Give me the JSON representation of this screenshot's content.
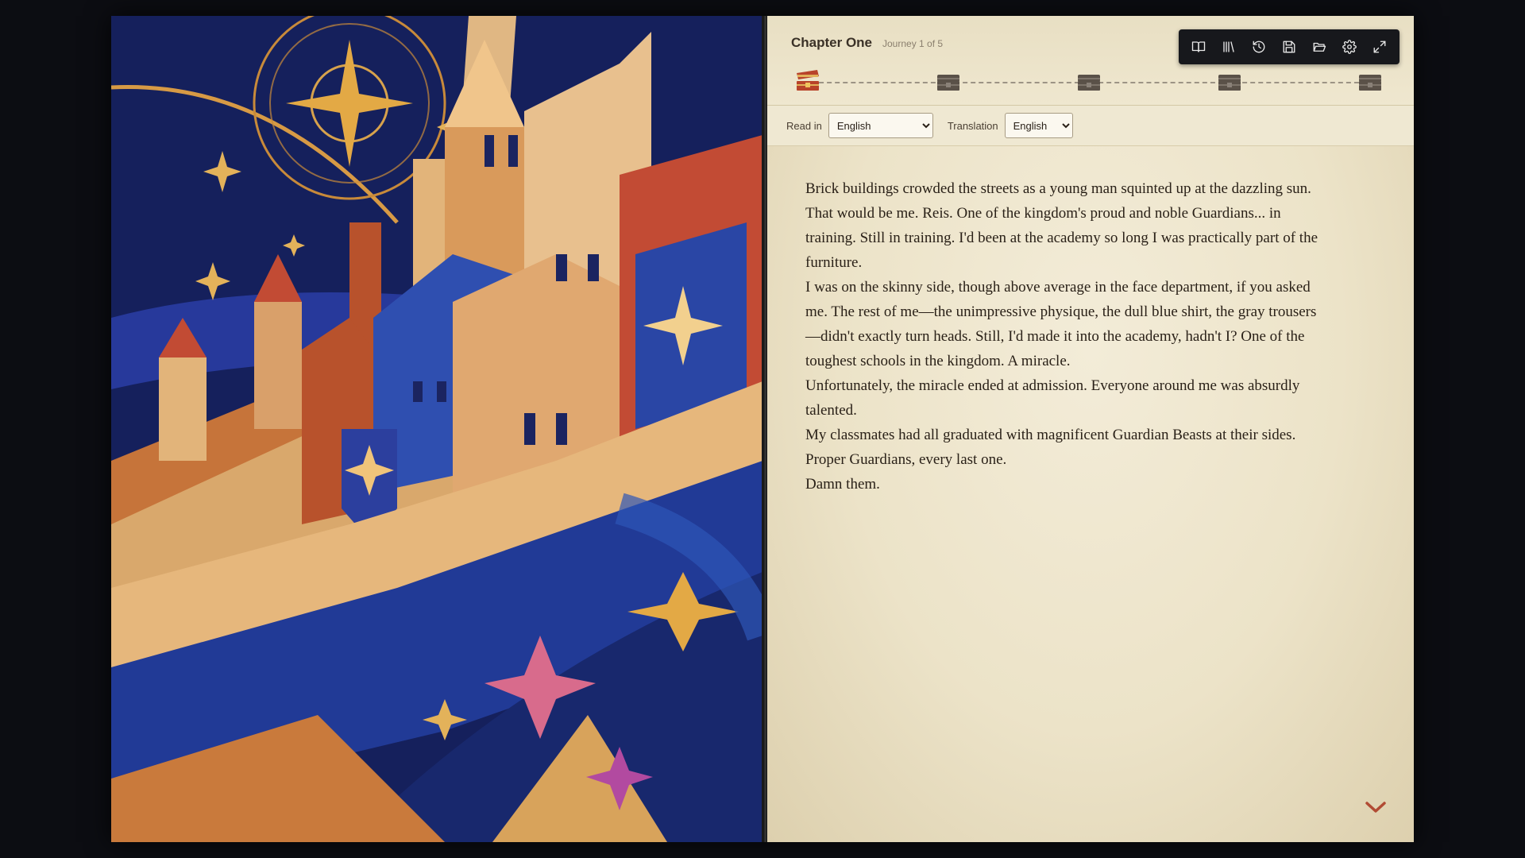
{
  "chapter": {
    "title": "Chapter One",
    "journey": "Journey 1 of 5"
  },
  "toolbar": {
    "buttons": [
      {
        "name": "book-icon"
      },
      {
        "name": "library-icon"
      },
      {
        "name": "history-icon"
      },
      {
        "name": "save-icon"
      },
      {
        "name": "folder-open-icon"
      },
      {
        "name": "gear-icon"
      },
      {
        "name": "fullscreen-icon"
      }
    ]
  },
  "progress": {
    "total": 5,
    "current": 1,
    "milestones": [
      "chest-icon",
      "chest-icon",
      "chest-icon",
      "chest-icon",
      "chest-icon"
    ],
    "active_color": "#b8432a",
    "inactive_color": "#5a5148"
  },
  "language": {
    "read_in_label": "Read in",
    "read_in_value": "English",
    "translation_label": "Translation",
    "translation_value": "English"
  },
  "story": {
    "paragraphs": [
      "Brick buildings crowded the streets as a young man squinted up at the dazzling sun.",
      "That would be me. Reis. One of the kingdom's proud and noble Guardians... in training. Still in training. I'd been at the academy so long I was practically part of the furniture.",
      "I was on the skinny side, though above average in the face department, if you asked me. The rest of me—the unimpressive physique, the dull blue shirt, the gray trousers—didn't exactly turn heads. Still, I'd made it into the academy, hadn't I? One of the toughest schools in the kingdom. A miracle.",
      "Unfortunately, the miracle ended at admission. Everyone around me was absurdly talented.",
      "My classmates had all graduated with magnificent Guardian Beasts at their sides. Proper Guardians, every last one.",
      "Damn them."
    ]
  },
  "colors": {
    "page_background": "#efe7cf",
    "text": "#2a2118",
    "scroll_arrow": "#b14b33"
  }
}
